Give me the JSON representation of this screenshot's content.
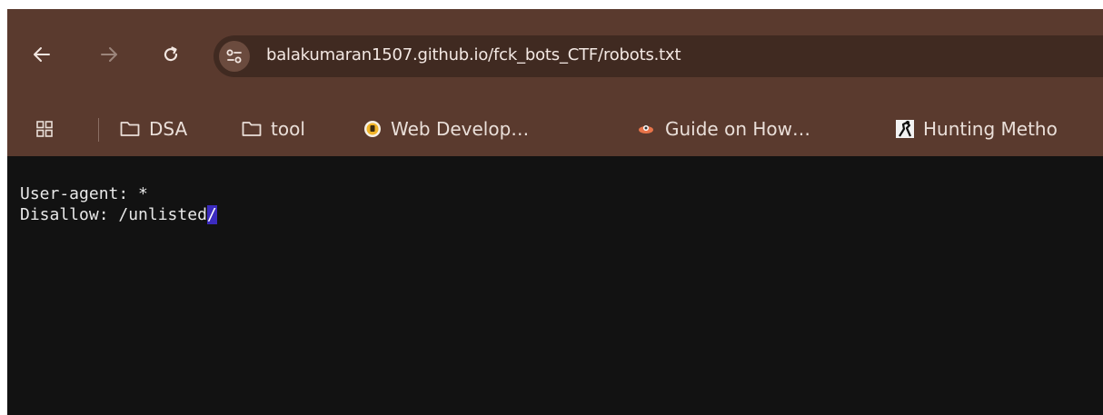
{
  "browser": {
    "url": "balakumaran1507.github.io/fck_bots_CTF/robots.txt"
  },
  "bookmarks": {
    "items": [
      {
        "label": "DSA",
        "icon": "folder-icon"
      },
      {
        "label": "tool",
        "icon": "folder-icon"
      },
      {
        "label": "Web Develop…",
        "icon": "site-favicon-yellow"
      },
      {
        "label": "Guide on How…",
        "icon": "site-favicon-orange"
      },
      {
        "label": "Hunting Metho",
        "icon": "site-favicon-figure"
      }
    ]
  },
  "page": {
    "line1": "User-agent: *",
    "line2_prefix": "Disallow: /unlisted",
    "line2_selected": "/"
  },
  "colors": {
    "chrome": "#5a3a2e",
    "omnibox": "#402a21",
    "content_bg": "#121212",
    "selection": "#3b2bbf"
  }
}
